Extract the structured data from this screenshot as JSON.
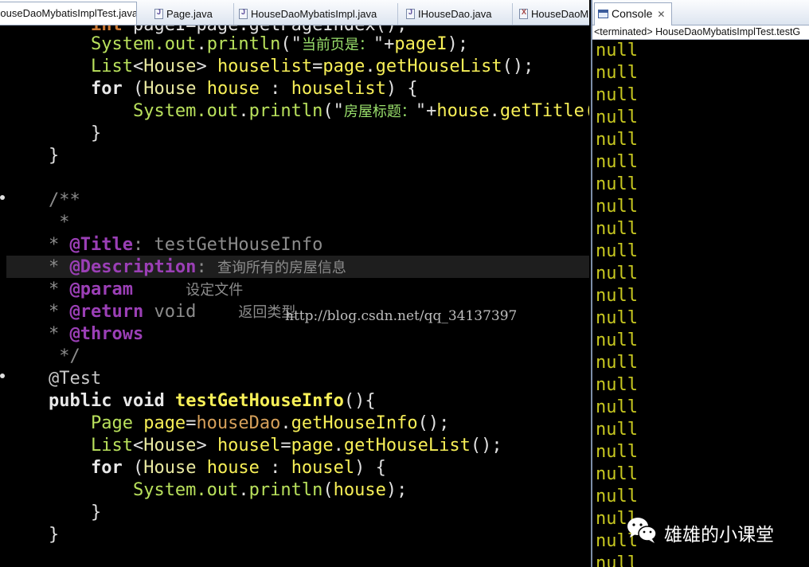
{
  "editor_tabs": [
    {
      "label": "HouseDaoMybatisImplTest.java",
      "icon": "java-file-icon",
      "active": true
    },
    {
      "label": "Page.java",
      "icon": "java-file-icon",
      "active": false
    },
    {
      "label": "HouseDaoMybatisImpl.java",
      "icon": "java-file-icon",
      "active": false
    },
    {
      "label": "IHouseDao.java",
      "icon": "java-file-icon",
      "active": false
    },
    {
      "label": "HouseDaoM",
      "icon": "xml-file-icon",
      "active": false
    }
  ],
  "code": {
    "l0": {
      "a": "int",
      "b": "pageI=page.getPageIndex();"
    },
    "l1": {
      "pre": "System.",
      "out": "out",
      "dot": ".",
      "m": "println",
      "p": "(\"",
      "s": "当前页是：",
      "q": "\"+",
      "v": "pageI",
      "e": ");"
    },
    "l2": {
      "t": "List",
      "lt": "<",
      "t2": "House",
      "gt": "> ",
      "v": "houselist",
      "eq": "=",
      "v2": "page",
      "dot": ".",
      "m": "getHouseList",
      "e": "();"
    },
    "l3": {
      "k": "for",
      "p": " (",
      "t": "House",
      "v": " house",
      "c": " : ",
      "v2": "houselist",
      "e": ") {"
    },
    "l4": {
      "pre": "System.",
      "out": "out",
      "dot": ".",
      "m": "println",
      "p": "(\"",
      "s": "房屋标题：",
      "q": "\"+",
      "v": "house",
      "dot2": ".",
      "m2": "getTitle("
    },
    "l5": "}",
    "l6": "}",
    "l7": "/**",
    "l8": " *",
    "l9": {
      "star": "* ",
      "tag": "@Title",
      "rest": ": testGetHouseInfo"
    },
    "l10": {
      "star": "* ",
      "tag": "@Description",
      "rest": ": ",
      "zh": "查询所有的房屋信息"
    },
    "l11": {
      "star": "* ",
      "tag": "@param",
      "zh": "设定文件"
    },
    "l12": {
      "star": "* ",
      "tag": "@return",
      "rest": " void",
      "zh": "返回类型"
    },
    "l13": {
      "star": "* ",
      "tag": "@throws"
    },
    "l14": " */",
    "l15": "@Test",
    "l16": {
      "k1": "public",
      "k2": " void ",
      "m": "testGetHouseInfo",
      "e": "(){"
    },
    "l17": {
      "t": "Page",
      "v": " page",
      "eq": "=",
      "f": "houseDao",
      "dot": ".",
      "m": "getHouseInfo",
      "e": "();"
    },
    "l18": {
      "t": "List",
      "lt": "<",
      "t2": "House",
      "gt": "> ",
      "v": "housel",
      "eq": "=",
      "v2": "page",
      "dot": ".",
      "m": "getHouseList",
      "e": "();"
    },
    "l19": {
      "k": "for",
      "p": " (",
      "t": "House",
      "v": " house",
      "c": " : ",
      "v2": "housel",
      "e": ") {"
    },
    "l20": {
      "pre": "System.",
      "out": "out",
      "dot": ".",
      "m": "println",
      "p": "(",
      "v": "house",
      "e": ");"
    },
    "l21": "}",
    "l22": "}"
  },
  "watermark_url": "http://blog.csdn.net/qq_34137397",
  "console": {
    "tab_label": "Console",
    "status": "<terminated> HouseDaoMybatisImplTest.testG",
    "output_line": "null"
  },
  "wechat": {
    "label": "雄雄的小课堂",
    "icon": "wechat-icon"
  },
  "colors": {
    "background": "#000000",
    "console_text": "#c8c820",
    "keyword": "#cc7832",
    "variable": "#f7ef57",
    "string": "#9ae06c"
  }
}
